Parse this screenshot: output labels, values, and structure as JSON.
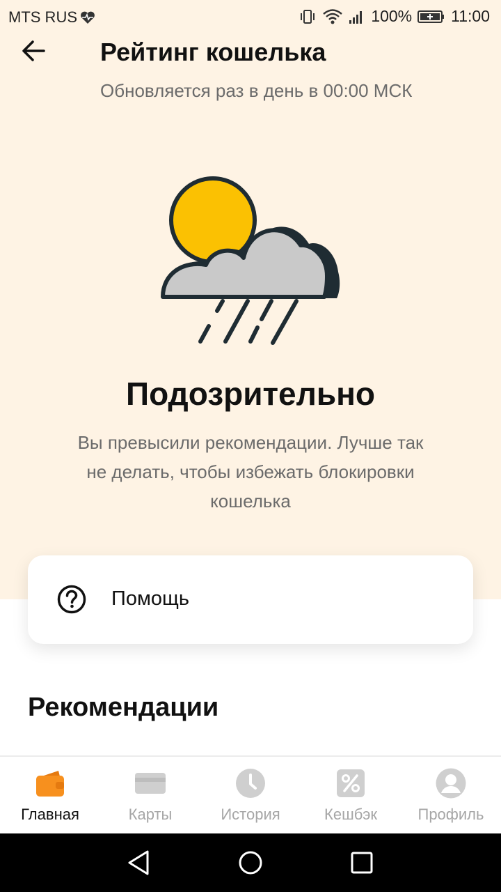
{
  "status_bar": {
    "carrier": "MTS RUS",
    "battery": "100%",
    "time": "11:00"
  },
  "header": {
    "title": "Рейтинг кошелька",
    "subtitle": "Обновляется раз в день в 00:00 МСК"
  },
  "rating": {
    "heading": "Подозрительно",
    "description": "Вы превысили рекомендации. Лучше так не делать, чтобы избежать блокировки кошелька"
  },
  "help": {
    "label": "Помощь"
  },
  "recommendations": {
    "title": "Рекомендации"
  },
  "bottom_nav": {
    "items": [
      {
        "label": "Главная",
        "icon": "wallet-icon",
        "active": true
      },
      {
        "label": "Карты",
        "icon": "card-icon",
        "active": false
      },
      {
        "label": "История",
        "icon": "clock-icon",
        "active": false
      },
      {
        "label": "Кешбэк",
        "icon": "percent-icon",
        "active": false
      },
      {
        "label": "Профиль",
        "icon": "profile-icon",
        "active": false
      }
    ]
  },
  "colors": {
    "accent": "#f7901e",
    "background_top": "#fef3e4",
    "sun": "#fbc102",
    "cloud": "#c9c9c9",
    "outline": "#1f2c33"
  }
}
